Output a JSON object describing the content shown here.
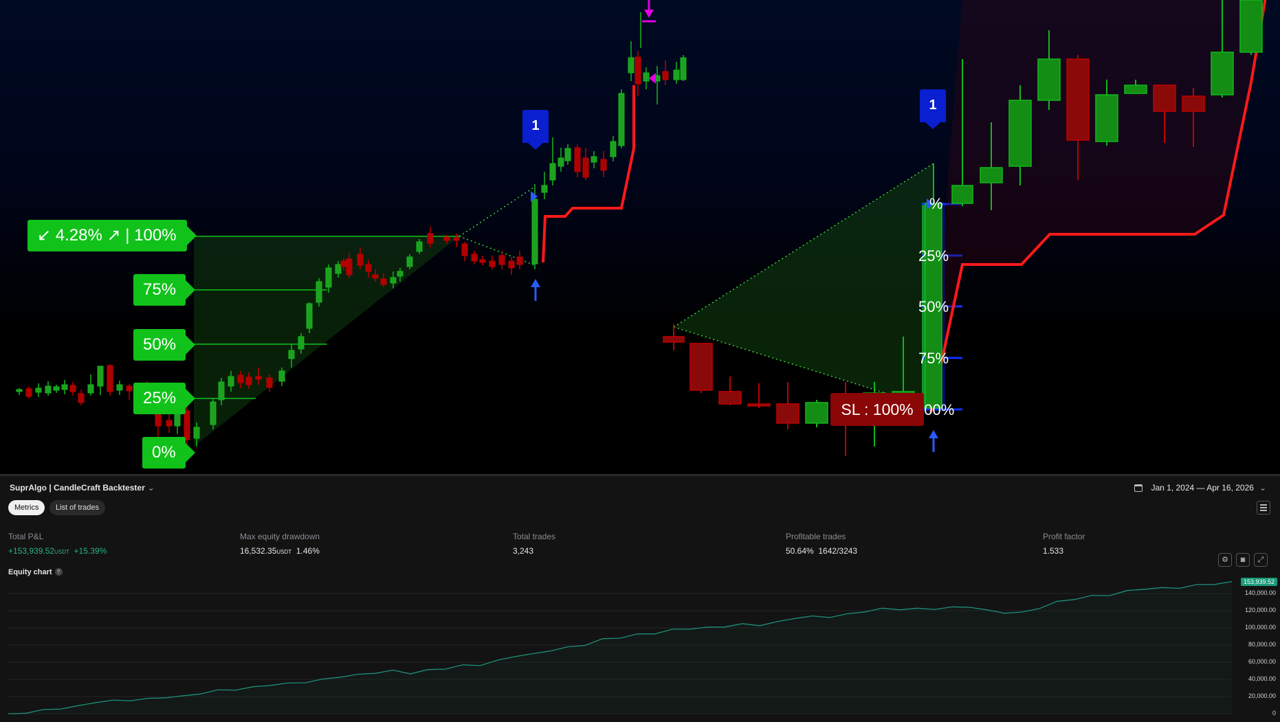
{
  "chart": {
    "levels_left": [
      {
        "key": "l100",
        "text": "↙ 4.28% ↗ | 100%"
      },
      {
        "key": "l75",
        "text": "75%"
      },
      {
        "key": "l50",
        "text": "50%"
      },
      {
        "key": "l25",
        "text": "25%"
      },
      {
        "key": "l0",
        "text": "0%"
      }
    ],
    "levels_right": [
      "%",
      "25%",
      "50%",
      "75%",
      "100%"
    ],
    "stop_loss_label": "SL : 100%",
    "trade_markers": [
      "1",
      "1"
    ],
    "colors": {
      "bull": "#11b81a",
      "bear": "#c00000",
      "trail": "#ff1a1a",
      "accent": "#0a1fd0",
      "zone_green": "#11c21a",
      "zone_red": "#8b0606",
      "signal_arrow": "#2a5bff",
      "exit_arrow": "#e000e0"
    },
    "icons": [
      "arrow-up-icon",
      "arrow-down-icon",
      "triangle-marker-icon"
    ]
  },
  "panel": {
    "title": "SuprAlgo | CandleCraft Backtester",
    "date_range": "Jan 1, 2024 — Apr 16, 2026",
    "tabs": [
      "Metrics",
      "List of trades"
    ],
    "metrics": [
      {
        "label": "Total P&L",
        "value": "+153,939.52",
        "unit": "USDT",
        "extra": "+15.39%"
      },
      {
        "label": "Max equity drawdown",
        "value": "16,532.35",
        "unit": "USDT",
        "extra": "1.46%"
      },
      {
        "label": "Total trades",
        "value": "3,243"
      },
      {
        "label": "Profitable trades",
        "value": "50.64%",
        "extra": "1642/3243"
      },
      {
        "label": "Profit factor",
        "value": "1.533"
      }
    ],
    "equity_title": "Equity chart",
    "help": "?",
    "equity_axis": [
      "140,000.00",
      "120,000.00",
      "100,000.00",
      "80,000.00",
      "60,000.00",
      "40,000.00",
      "20,000.00",
      "0"
    ],
    "equity_last": "153,939.52",
    "equity_points": [
      0,
      1500,
      3000,
      6000,
      8000,
      13000,
      15000,
      17000,
      17500,
      20000,
      21000,
      24000,
      26000,
      28000,
      30000,
      33000,
      35000,
      38000,
      40000,
      44000,
      46000,
      48000,
      49000,
      47000,
      50000,
      52000,
      56000,
      58000,
      62000,
      68000,
      70000,
      74000,
      76000,
      80000,
      86000,
      88000,
      92000,
      95000,
      98000,
      100000,
      101000,
      102000,
      103000,
      103000,
      106000,
      111000,
      113000,
      114000,
      116000,
      120000,
      123000,
      122000,
      121000,
      122000,
      123000,
      124000,
      120000,
      119000,
      118000,
      124000,
      131000,
      134000,
      136000,
      138000,
      142000,
      145000,
      146000,
      148000,
      150000,
      152000,
      153939.52
    ]
  }
}
